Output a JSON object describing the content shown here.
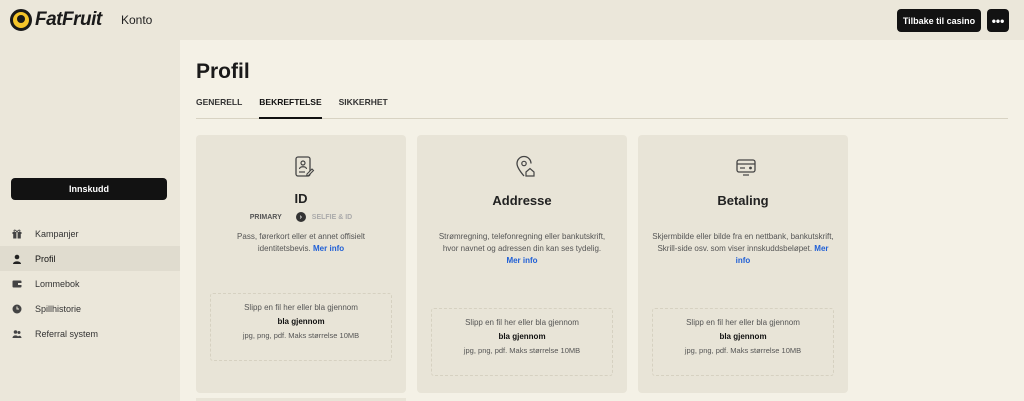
{
  "header": {
    "logo_text": "FatFruit",
    "section": "Konto",
    "back_button": "Tilbake til casino",
    "more_button": "•••"
  },
  "sidebar": {
    "deposit_button": "Innskudd",
    "items": [
      {
        "label": "Kampanjer",
        "icon": "gift-icon"
      },
      {
        "label": "Profil",
        "icon": "user-icon",
        "active": true
      },
      {
        "label": "Lommebok",
        "icon": "wallet-icon"
      },
      {
        "label": "Spillhistorie",
        "icon": "clock-icon"
      },
      {
        "label": "Referral system",
        "icon": "users-icon"
      }
    ]
  },
  "main": {
    "title": "Profil",
    "tabs": [
      {
        "label": "GENERELL"
      },
      {
        "label": "BEKREFTELSE",
        "active": true
      },
      {
        "label": "SIKKERHET"
      }
    ],
    "cards": [
      {
        "title": "ID",
        "icon": "id-card-icon",
        "step_primary": "PRIMARY",
        "step_secondary": "SELFIE & ID",
        "description": "Pass, førerkort eller et annet offisielt identitetsbevis.",
        "more_info": "Mer info",
        "drop_line1": "Slipp en fil her eller bla gjennom",
        "drop_line2": "bla gjennom",
        "drop_line3": "jpg, png, pdf. Maks størrelse 10MB"
      },
      {
        "title": "Addresse",
        "icon": "location-home-icon",
        "description": "Strømregning, telefonregning eller bankutskrift, hvor navnet og adressen din kan ses tydelig.",
        "more_info": "Mer info",
        "drop_line1": "Slipp en fil her eller bla gjennom",
        "drop_line2": "bla gjennom",
        "drop_line3": "jpg, png, pdf. Maks størrelse 10MB"
      },
      {
        "title": "Betaling",
        "icon": "payment-card-icon",
        "description": "Skjermbilde eller bilde fra en nettbank, bankutskrift, Skrill-side osv. som viser innskuddsbeløpet.",
        "more_info": "Mer info",
        "drop_line1": "Slipp en fil her eller bla gjennom",
        "drop_line2": "bla gjennom",
        "drop_line3": "jpg, png, pdf. Maks størrelse 10MB"
      }
    ]
  }
}
